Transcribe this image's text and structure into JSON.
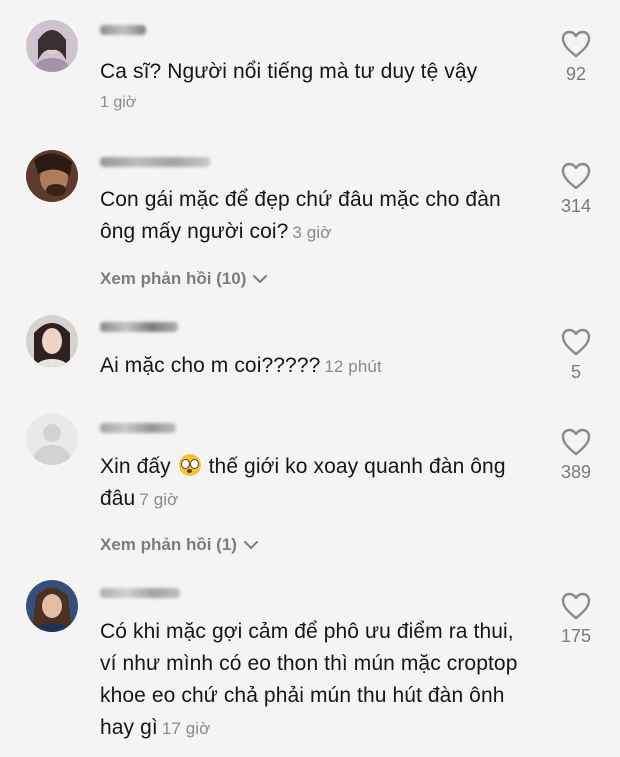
{
  "comments": [
    {
      "text": "Ca sĩ? Người nổi tiếng mà tư duy tệ vậy",
      "time": "1 giờ",
      "likes": "92"
    },
    {
      "text": "Con gái mặc để đẹp chứ đâu mặc cho đàn ông mấy người coi?",
      "time": "3 giờ",
      "likes": "314",
      "replies": "Xem phản hồi (10)"
    },
    {
      "text": "Ai mặc cho m coi?????",
      "time": "12 phút",
      "likes": "5"
    },
    {
      "text_before": "Xin đấy",
      "text_after": "thế giới ko xoay quanh đàn ông đâu",
      "emoji": "flushed-face-emoji",
      "time": "7 giờ",
      "likes": "389",
      "replies": "Xem phản hồi (1)"
    },
    {
      "text": "Có khi mặc gợi cảm để phô ưu điểm ra thui, ví như mình có eo thon thì mún mặc croptop khoe eo chứ chả phải mún thu hút đàn ônh hay gì",
      "time": "17 giờ",
      "likes": "175"
    }
  ],
  "icons": {
    "like": "heart-outline-icon",
    "expand": "chevron-down-icon"
  },
  "colors": {
    "background": "#f4f4f4",
    "text": "#161616",
    "muted": "#8a8a8a"
  }
}
